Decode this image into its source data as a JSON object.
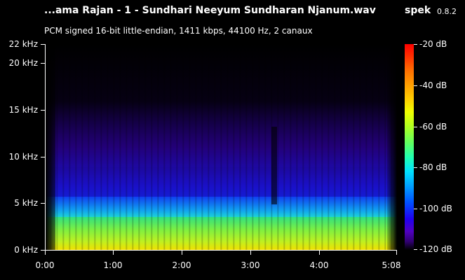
{
  "header": {
    "file_title": "...ama Rajan - 1 - Sundhari Neeyum Sundharan Njanum.wav",
    "app_name": "spek",
    "app_version": "0.8.2",
    "audio_info": "PCM signed 16-bit little-endian, 1411 kbps, 44100 Hz, 2 canaux"
  },
  "frequency_axis": {
    "labels": [
      "22 kHz",
      "20 kHz",
      "15 kHz",
      "10 kHz",
      "5 kHz",
      "0 kHz"
    ]
  },
  "time_axis": {
    "labels": [
      "0:00",
      "1:00",
      "2:00",
      "3:00",
      "4:00",
      "5:08"
    ]
  },
  "colorbar": {
    "labels": [
      "-20 dB",
      "-40 dB",
      "-60 dB",
      "-80 dB",
      "-100 dB",
      "-120 dB"
    ]
  }
}
